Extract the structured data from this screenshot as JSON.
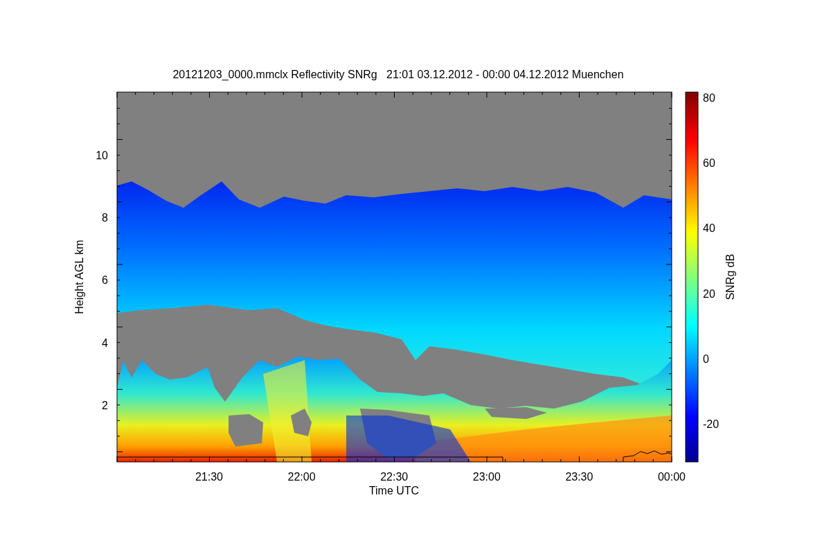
{
  "title": "20121203_0000.mmclx Reflectivity SNRg   21:01 03.12.2012 - 00:00 04.12.2012 Muenchen",
  "plot": {
    "xlabel": "Time UTC",
    "ylabel": "Height AGL km",
    "xtick_labels": [
      "21:30",
      "22:00",
      "22:30",
      "23:00",
      "23:30",
      "00:00"
    ],
    "ytick_labels": [
      "10",
      "8",
      "6",
      "4",
      "2"
    ]
  },
  "colorbar": {
    "label": "SNRg dB",
    "tick_labels": [
      "80",
      "60",
      "40",
      "20",
      "0",
      "-20"
    ]
  }
}
